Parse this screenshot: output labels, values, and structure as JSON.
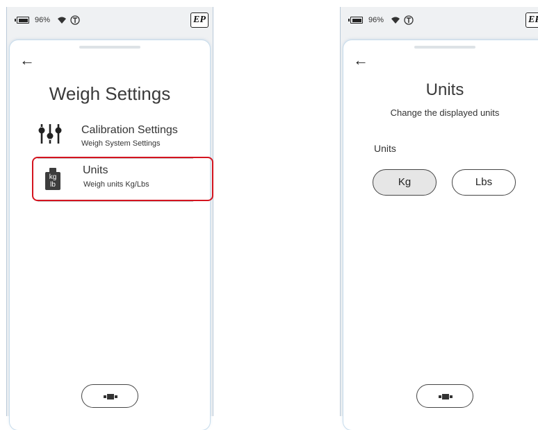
{
  "left_screen": {
    "status": {
      "battery_percent": "96%"
    },
    "logo": "EP",
    "title": "Weigh Settings",
    "menu": [
      {
        "label": "Calibration Settings",
        "sub": "Weigh System Settings",
        "icon": "sliders-icon"
      },
      {
        "label": "Units",
        "sub": "Weigh units Kg/Lbs",
        "icon": "kg-lb-weight-icon",
        "highlighted": true
      }
    ],
    "kg_text": "kg",
    "lb_text": "lb"
  },
  "right_screen": {
    "status": {
      "battery_percent": "96%"
    },
    "logo": "EP",
    "title": "Units",
    "subtitle": "Change the displayed units",
    "section_label": "Units",
    "options": [
      {
        "label": "Kg",
        "selected": true
      },
      {
        "label": "Lbs",
        "selected": false
      }
    ]
  },
  "colors": {
    "highlight": "#d4141f",
    "selected_bg": "#e6e6e6"
  }
}
